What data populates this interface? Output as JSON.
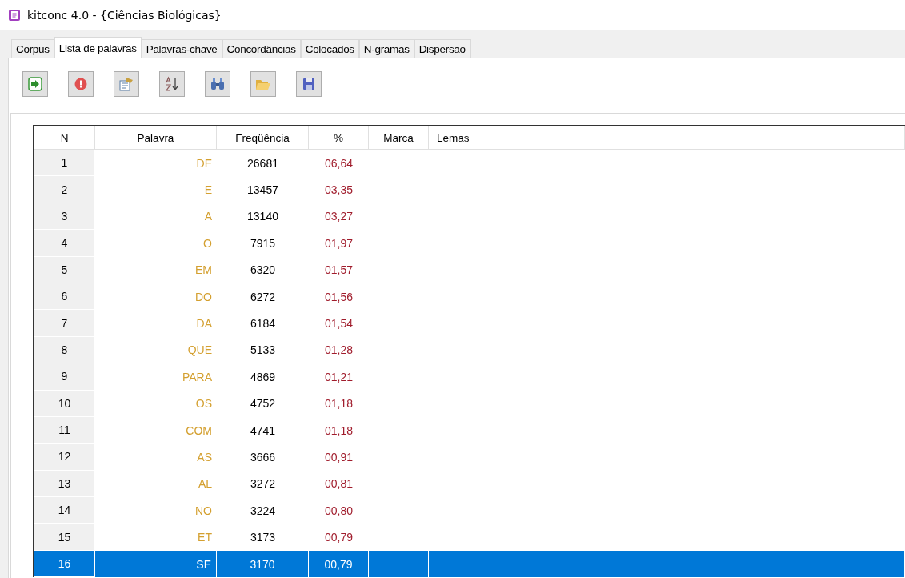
{
  "window": {
    "title": "kitconc 4.0 - {Ciências Biológicas}"
  },
  "tabs": [
    {
      "label": "Corpus",
      "selected": false
    },
    {
      "label": "Lista de palavras",
      "selected": true
    },
    {
      "label": "Palavras-chave",
      "selected": false
    },
    {
      "label": "Concordâncias",
      "selected": false
    },
    {
      "label": "Colocados",
      "selected": false
    },
    {
      "label": "N-gramas",
      "selected": false
    },
    {
      "label": "Dispersão",
      "selected": false
    }
  ],
  "toolbar": [
    {
      "kind": "run"
    },
    {
      "kind": "stop"
    },
    {
      "kind": "settings"
    },
    {
      "kind": "sort"
    },
    {
      "kind": "find"
    },
    {
      "kind": "open"
    },
    {
      "kind": "save"
    }
  ],
  "table": {
    "columns": [
      "N",
      "Palavra",
      "Freqüência",
      "%",
      "Marca",
      "Lemas"
    ],
    "rows": [
      {
        "n": "1",
        "word": "DE",
        "freq": "26681",
        "pct": "06,64",
        "selected": false
      },
      {
        "n": "2",
        "word": "E",
        "freq": "13457",
        "pct": "03,35",
        "selected": false
      },
      {
        "n": "3",
        "word": "A",
        "freq": "13140",
        "pct": "03,27",
        "selected": false
      },
      {
        "n": "4",
        "word": "O",
        "freq": "7915",
        "pct": "01,97",
        "selected": false
      },
      {
        "n": "5",
        "word": "EM",
        "freq": "6320",
        "pct": "01,57",
        "selected": false
      },
      {
        "n": "6",
        "word": "DO",
        "freq": "6272",
        "pct": "01,56",
        "selected": false
      },
      {
        "n": "7",
        "word": "DA",
        "freq": "6184",
        "pct": "01,54",
        "selected": false
      },
      {
        "n": "8",
        "word": "QUE",
        "freq": "5133",
        "pct": "01,28",
        "selected": false
      },
      {
        "n": "9",
        "word": "PARA",
        "freq": "4869",
        "pct": "01,21",
        "selected": false
      },
      {
        "n": "10",
        "word": "OS",
        "freq": "4752",
        "pct": "01,18",
        "selected": false
      },
      {
        "n": "11",
        "word": "COM",
        "freq": "4741",
        "pct": "01,18",
        "selected": false
      },
      {
        "n": "12",
        "word": "AS",
        "freq": "3666",
        "pct": "00,91",
        "selected": false
      },
      {
        "n": "13",
        "word": "AL",
        "freq": "3272",
        "pct": "00,81",
        "selected": false
      },
      {
        "n": "14",
        "word": "NO",
        "freq": "3224",
        "pct": "00,80",
        "selected": false
      },
      {
        "n": "15",
        "word": "ET",
        "freq": "3173",
        "pct": "00,79",
        "selected": false
      },
      {
        "n": "16",
        "word": "SE",
        "freq": "3170",
        "pct": "00,79",
        "selected": true
      }
    ]
  }
}
